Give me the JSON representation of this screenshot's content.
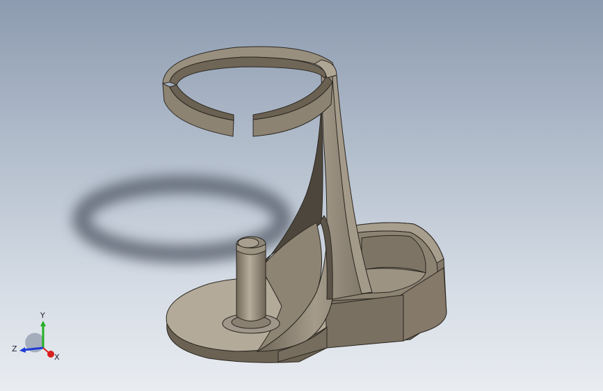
{
  "viewport": {
    "name": "3d-graphics-area"
  },
  "model": {
    "part_color": "#8f8575",
    "part_light": "#b2a898",
    "part_dark": "#5f574b",
    "edge_color": "#2a261f"
  },
  "triad": {
    "x_label": "X",
    "y_label": "Y",
    "z_label": "Z",
    "x_color": "#d81e1e",
    "y_color": "#22b022",
    "z_color": "#1e3ad8"
  }
}
